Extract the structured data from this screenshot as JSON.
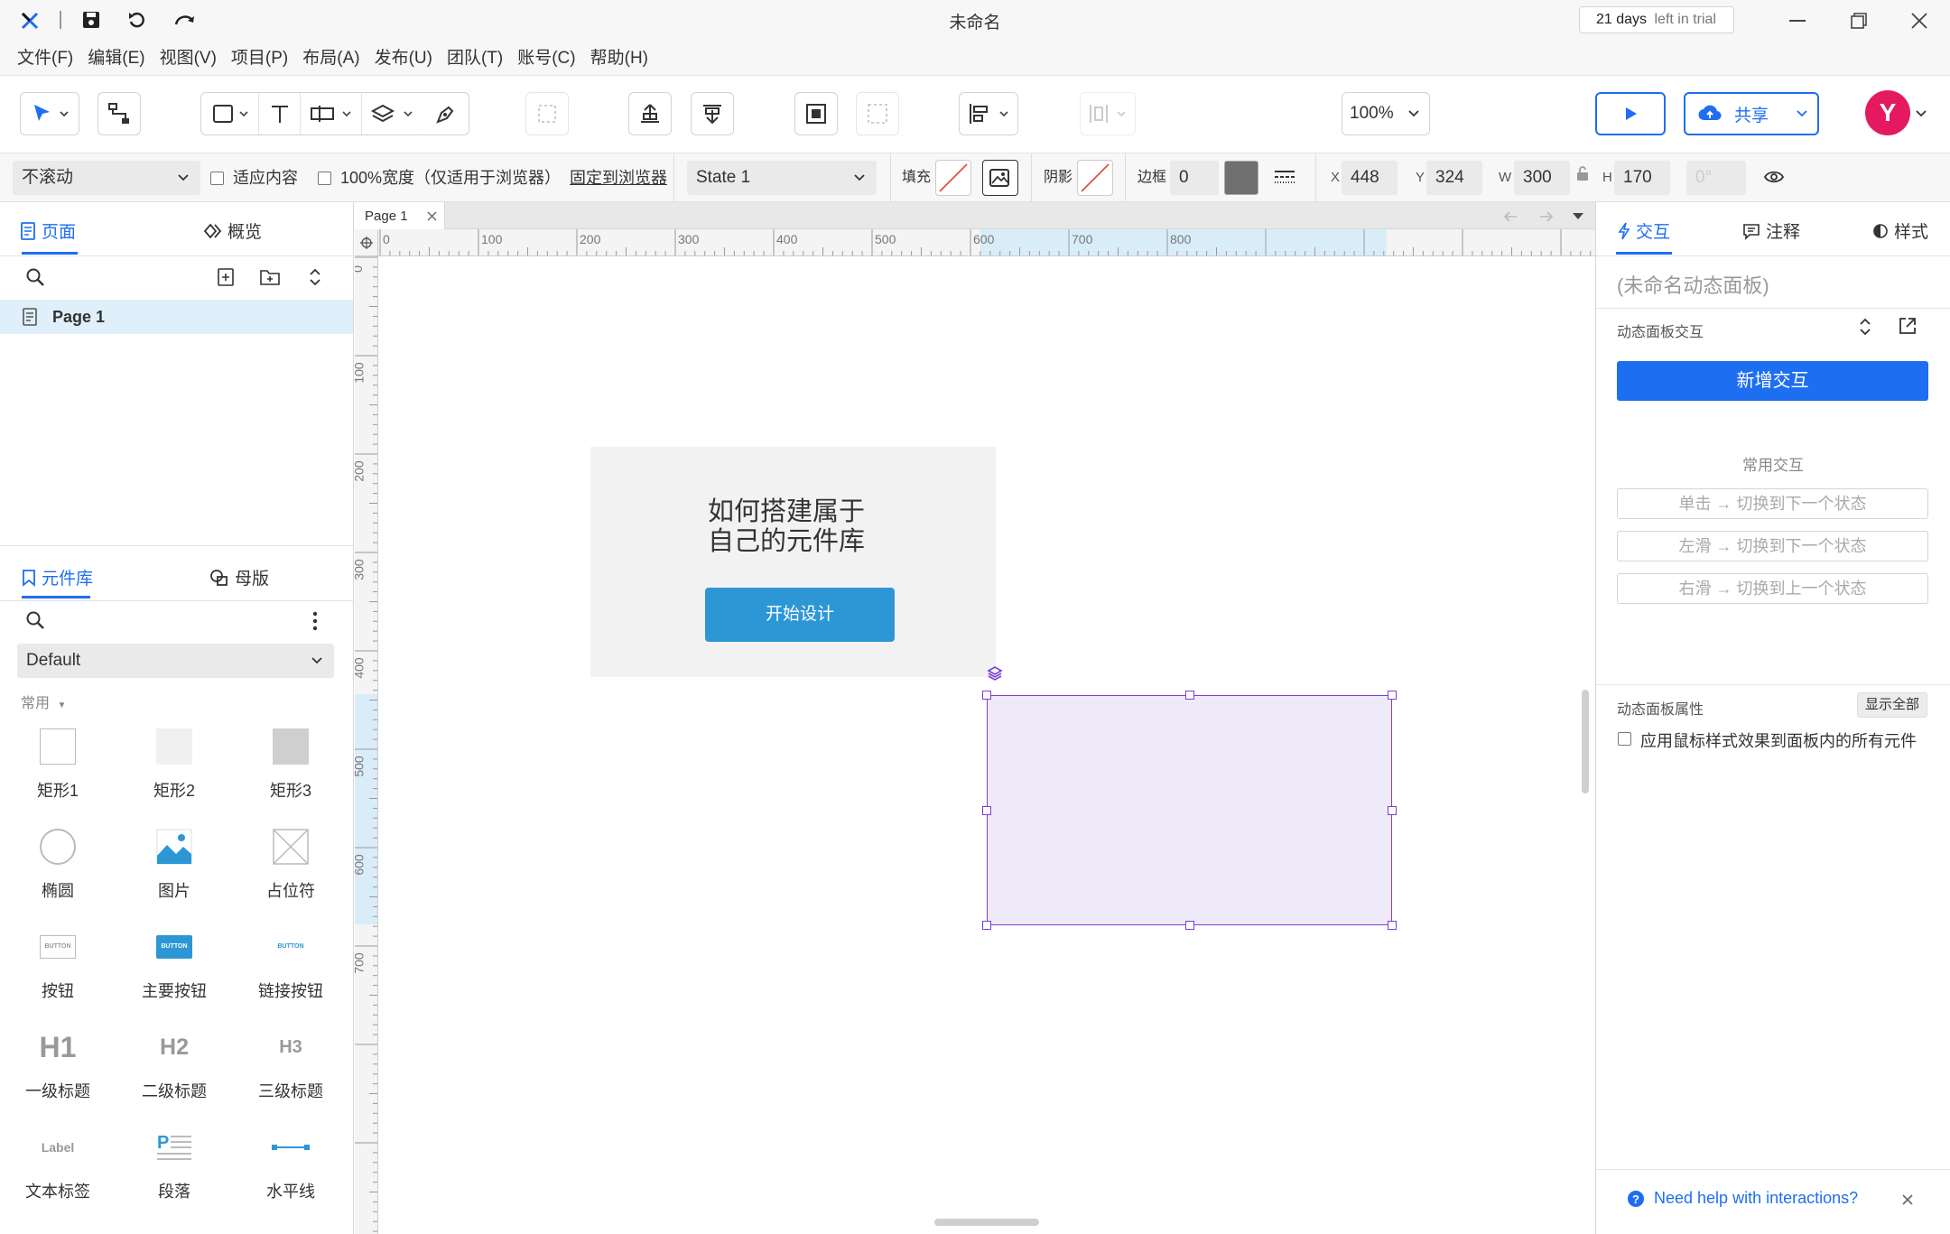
{
  "app": {
    "title": "未命名",
    "trial_days": "21 days",
    "trial_suffix": "left in trial"
  },
  "menu": [
    "文件(F)",
    "编辑(E)",
    "视图(V)",
    "项目(P)",
    "布局(A)",
    "发布(U)",
    "团队(T)",
    "账号(C)",
    "帮助(H)"
  ],
  "toolbar": {
    "zoom": "100%",
    "share_label": "共享",
    "avatar_letter": "Y"
  },
  "propbar": {
    "scroll_select": "不滚动",
    "fit_content": "适应内容",
    "full_width": "100%宽度（仅适用于浏览器）",
    "pin_browser": "固定到浏览器",
    "state_select": "State 1",
    "fill_label": "填充",
    "shadow_label": "阴影",
    "border_label": "边框",
    "border_value": "0",
    "x_label": "X",
    "x_value": "448",
    "y_label": "Y",
    "y_value": "324",
    "w_label": "W",
    "w_value": "300",
    "h_label": "H",
    "h_value": "170",
    "rotation": "0°"
  },
  "left": {
    "tab_pages": "页面",
    "tab_outline": "概览",
    "page_item": "Page 1",
    "tab_library": "元件库",
    "tab_masters": "母版",
    "library_select": "Default",
    "section": "常用",
    "items": [
      "矩形1",
      "矩形2",
      "矩形3",
      "椭圆",
      "图片",
      "占位符",
      "按钮",
      "主要按钮",
      "链接按钮",
      "一级标题",
      "二级标题",
      "三级标题",
      "文本标签",
      "段落",
      "水平线"
    ],
    "button_text": "BUTTON",
    "label_text": "Label",
    "h1": "H1",
    "h2": "H2",
    "h3": "H3"
  },
  "canvas": {
    "tab": "Page 1",
    "ruler_h": [
      "0",
      "100",
      "200",
      "300",
      "400",
      "500",
      "600",
      "700",
      "800"
    ],
    "ruler_v": [
      "0",
      "100",
      "200",
      "300",
      "400",
      "500",
      "600",
      "700"
    ],
    "card_title_line1": "如何搭建属于",
    "card_title_line2": "自己的元件库",
    "card_button": "开始设计"
  },
  "right": {
    "tab_interactions": "交互",
    "tab_notes": "注释",
    "tab_style": "样式",
    "panel_name": "(未命名动态面板)",
    "section_interactions": "动态面板交互",
    "add_interaction": "新增交互",
    "common_title": "常用交互",
    "common": [
      "单击 → 切换到下一个状态",
      "左滑 → 切换到下一个状态",
      "右滑 → 切换到上一个状态"
    ],
    "props_title": "动态面板属性",
    "show_all": "显示全部",
    "apply_cursor": "应用鼠标样式效果到面板内的所有元件",
    "help": "Need help with interactions?"
  },
  "colors": {
    "accent": "#1e6ef2",
    "primary_button": "#2d97d6",
    "selection": "#7b3fd6",
    "avatar": "#e5195f"
  }
}
